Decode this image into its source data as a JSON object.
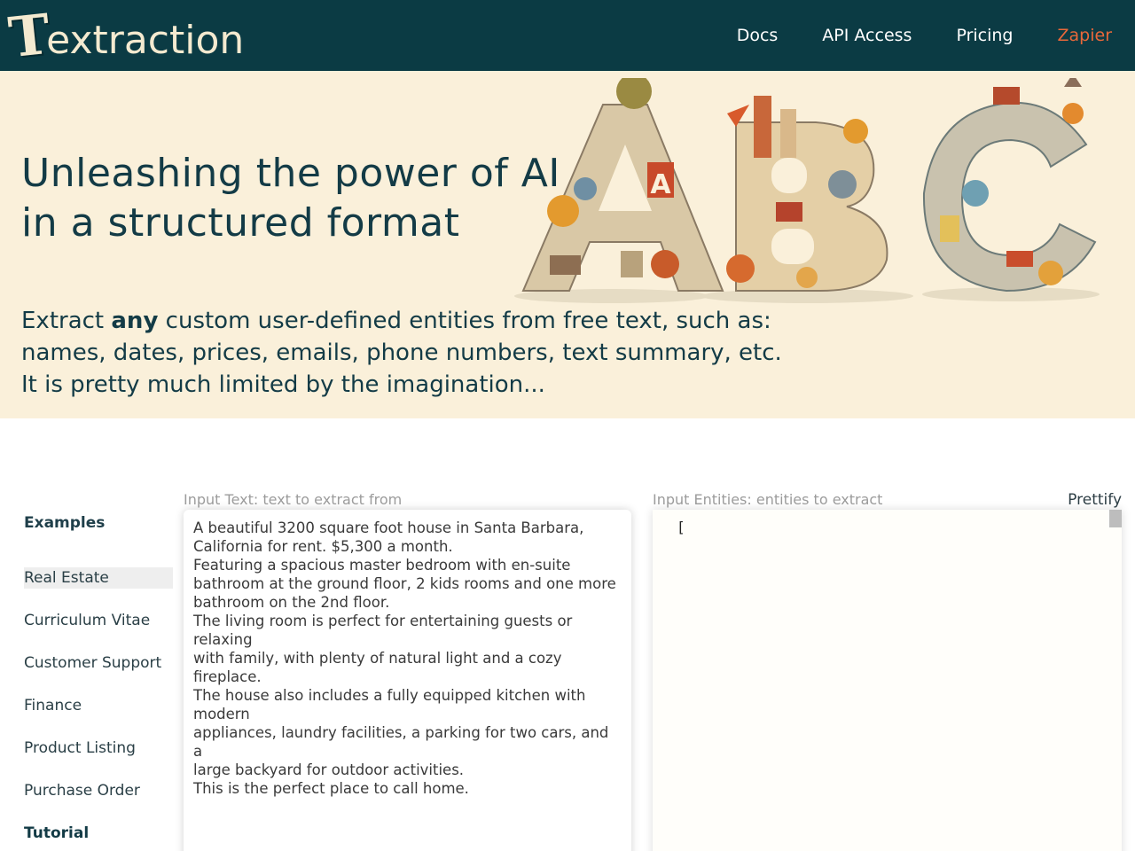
{
  "nav": {
    "logo_first": "T",
    "logo_rest": "extraction",
    "links": [
      "Docs",
      "API Access",
      "Pricing",
      "Zapier"
    ]
  },
  "hero": {
    "title_line1": "Unleashing the power of AI",
    "title_line2": "in a structured format",
    "sub_before": "Extract ",
    "sub_bold": "any",
    "sub_after": " custom user-defined entities from free text, such as:",
    "sub_line2": "names, dates, prices, emails, phone numbers, text summary, etc.",
    "sub_line3": "It is pretty much limited by the imagination...",
    "art_letters": [
      "A",
      "B",
      "C"
    ]
  },
  "examples": {
    "title": "Examples",
    "items": [
      "Real Estate",
      "Curriculum Vitae",
      "Customer Support",
      "Finance",
      "Product Listing",
      "Purchase Order",
      "Tutorial"
    ],
    "active": "Real Estate"
  },
  "editor": {
    "input_label": "Input Text: text to extract from",
    "entities_label": "Input Entities: entities to extract",
    "prettify_label": "Prettify",
    "input_text": "A beautiful 3200 square foot house in Santa Barbara,\nCalifornia for rent. $5,300 a month.\nFeaturing a spacious master bedroom with en-suite\nbathroom at the ground floor, 2 kids rooms and one more\nbathroom on the 2nd floor.\nThe living room is perfect for entertaining guests or relaxing\nwith family, with plenty of natural light and a cozy fireplace.\nThe house also includes a fully equipped kitchen with modern\nappliances, laundry facilities, a parking for two cars, and a\nlarge backyard for outdoor activities.\nThis is the perfect place to call home.",
    "entities_text": "["
  },
  "colors": {
    "nav_bg": "#0b3b44",
    "hero_bg": "#faf0da",
    "accent": "#e8683a",
    "title": "#133b46"
  }
}
